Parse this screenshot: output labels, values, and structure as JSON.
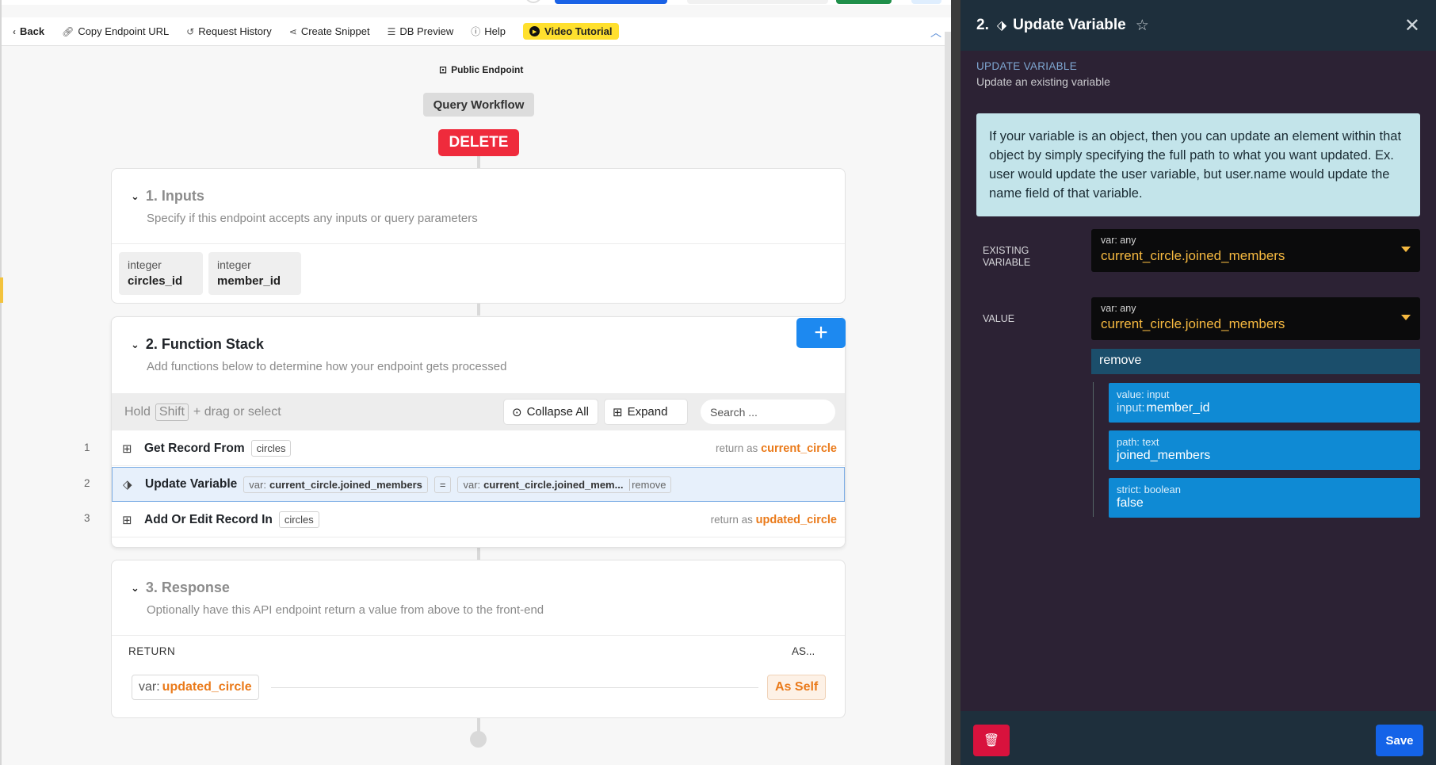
{
  "toolbar": {
    "back": "Back",
    "copy_endpoint": "Copy Endpoint URL",
    "request_history": "Request History",
    "create_snippet": "Create Snippet",
    "db_preview": "DB Preview",
    "help": "Help",
    "video_tutorial": "Video Tutorial"
  },
  "endpoint": {
    "public_label": "Public Endpoint",
    "workflow_badge": "Query Workflow",
    "method": "DELETE"
  },
  "inputs_section": {
    "title": "1. Inputs",
    "subtitle": "Specify if this endpoint accepts any inputs or query parameters",
    "items": [
      {
        "type": "integer",
        "name": "circles_id"
      },
      {
        "type": "integer",
        "name": "member_id"
      }
    ]
  },
  "function_stack": {
    "title": "2. Function Stack",
    "subtitle": "Add functions below to determine how your endpoint gets processed",
    "hint_prefix": "Hold",
    "hint_key": "Shift",
    "hint_suffix": "+ drag or select",
    "collapse_all": "Collapse All",
    "expand": "Expand",
    "search_placeholder": "Search ...",
    "rows": [
      {
        "num": "1",
        "name": "Get Record From",
        "tag": "circles",
        "return_prefix": "return as",
        "return_var": "current_circle"
      },
      {
        "num": "2",
        "name": "Update Variable",
        "lhs_label": "var:",
        "lhs_value": "current_circle.joined_members",
        "op": "=",
        "rhs_label": "var:",
        "rhs_value": "current_circle.joined_mem...",
        "rhs_filter": "remove"
      },
      {
        "num": "3",
        "name": "Add Or Edit Record In",
        "tag": "circles",
        "return_prefix": "return as",
        "return_var": "updated_circle"
      }
    ]
  },
  "response_section": {
    "title": "3. Response",
    "subtitle": "Optionally have this API endpoint return a value from above to the front-end",
    "return_label": "RETURN",
    "as_label": "AS...",
    "var_label": "var:",
    "var_value": "updated_circle",
    "as_value": "As Self"
  },
  "panel": {
    "header_num": "2.",
    "header_title": "Update Variable",
    "section_title": "UPDATE VARIABLE",
    "section_sub": "Update an existing variable",
    "info_text": "If your variable is an object, then you can update an element within that object by simply specifying the full path to what you want updated. Ex. user would update the user variable, but user.name would update the name field of that variable.",
    "existing_label_1": "EXISTING",
    "existing_label_2": "VARIABLE",
    "existing_type": "var: any",
    "existing_value": "current_circle.joined_members",
    "value_label": "VALUE",
    "value_type": "var: any",
    "value_value": "current_circle.joined_members",
    "filter_name": "remove",
    "args": [
      {
        "label": "value: input",
        "prefix": "input:",
        "value": "member_id"
      },
      {
        "label": "path: text",
        "prefix": "",
        "value": "joined_members"
      },
      {
        "label": "strict: boolean",
        "prefix": "",
        "value": "false"
      }
    ],
    "save": "Save"
  },
  "colors": {
    "accent_orange": "#ea7a1a",
    "delete_red": "#ef2b3c",
    "panel_bg": "#2c2234",
    "arg_blue": "#0f8ad4",
    "var_yellow": "#f6b940"
  }
}
